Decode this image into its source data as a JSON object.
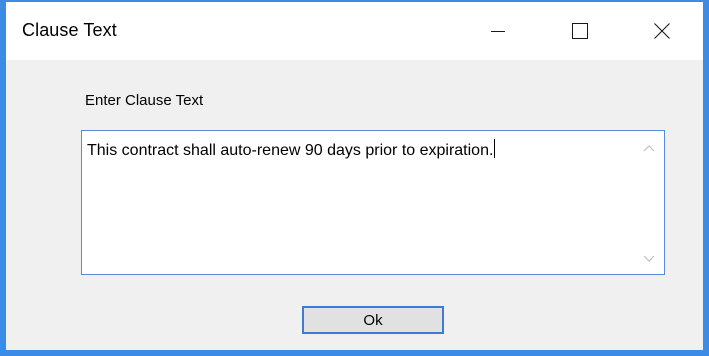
{
  "window": {
    "title": "Clause Text",
    "accent_color": "#3c8be6"
  },
  "caption_buttons": {
    "minimize_icon": "minimize-icon",
    "maximize_icon": "maximize-icon",
    "close_icon": "close-icon"
  },
  "form": {
    "label": "Enter Clause Text",
    "clause_text": "This contract shall auto-renew 90 days prior to expiration."
  },
  "scrollbar": {
    "up_icon": "chevron-up-icon",
    "down_icon": "chevron-down-icon"
  },
  "buttons": {
    "ok_label": "Ok"
  }
}
